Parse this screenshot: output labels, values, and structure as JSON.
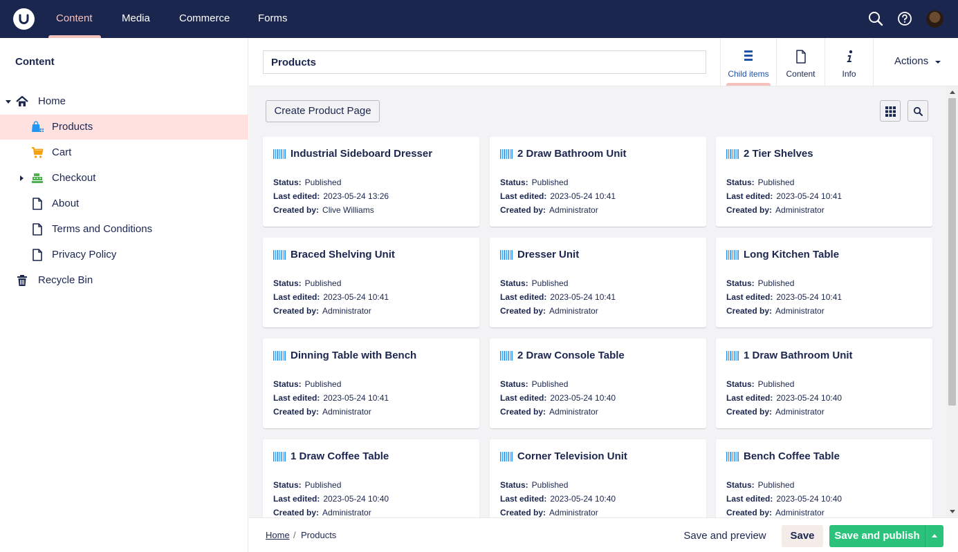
{
  "topbar": {
    "sections": [
      "Content",
      "Media",
      "Commerce",
      "Forms"
    ],
    "active_section": "Content"
  },
  "sidebar": {
    "title": "Content",
    "items": [
      {
        "label": "Home",
        "icon": "home-icon"
      },
      {
        "label": "Products",
        "icon": "shopping-bag-icon"
      },
      {
        "label": "Cart",
        "icon": "cart-icon"
      },
      {
        "label": "Checkout",
        "icon": "cash-register-icon"
      },
      {
        "label": "About",
        "icon": "document-icon"
      },
      {
        "label": "Terms and Conditions",
        "icon": "document-icon"
      },
      {
        "label": "Privacy Policy",
        "icon": "document-icon"
      },
      {
        "label": "Recycle Bin",
        "icon": "trash-icon"
      }
    ],
    "selected": "Products"
  },
  "header": {
    "name_value": "Products",
    "tabs": [
      {
        "label": "Child items",
        "icon": "list-icon"
      },
      {
        "label": "Content",
        "icon": "document-icon"
      },
      {
        "label": "Info",
        "icon": "info-icon"
      }
    ],
    "active_tab": "Child items",
    "actions_label": "Actions"
  },
  "toolbar": {
    "create_label": "Create Product Page"
  },
  "labels": {
    "status": "Status:",
    "last_edited": "Last edited:",
    "created_by": "Created by:"
  },
  "cards": [
    {
      "title": "Industrial Sideboard Dresser",
      "status": "Published",
      "last_edited": "2023-05-24 13:26",
      "created_by": "Clive Williams"
    },
    {
      "title": "2 Draw Bathroom Unit",
      "status": "Published",
      "last_edited": "2023-05-24 10:41",
      "created_by": "Administrator"
    },
    {
      "title": "2 Tier Shelves",
      "status": "Published",
      "last_edited": "2023-05-24 10:41",
      "created_by": "Administrator"
    },
    {
      "title": "Braced Shelving Unit",
      "status": "Published",
      "last_edited": "2023-05-24 10:41",
      "created_by": "Administrator"
    },
    {
      "title": "Dresser Unit",
      "status": "Published",
      "last_edited": "2023-05-24 10:41",
      "created_by": "Administrator"
    },
    {
      "title": "Long Kitchen Table",
      "status": "Published",
      "last_edited": "2023-05-24 10:41",
      "created_by": "Administrator"
    },
    {
      "title": "Dinning Table with Bench",
      "status": "Published",
      "last_edited": "2023-05-24 10:41",
      "created_by": "Administrator"
    },
    {
      "title": "2 Draw Console Table",
      "status": "Published",
      "last_edited": "2023-05-24 10:40",
      "created_by": "Administrator"
    },
    {
      "title": "1 Draw Bathroom Unit",
      "status": "Published",
      "last_edited": "2023-05-24 10:40",
      "created_by": "Administrator"
    },
    {
      "title": "1 Draw Coffee Table",
      "status": "Published",
      "last_edited": "2023-05-24 10:40",
      "created_by": "Administrator"
    },
    {
      "title": "Corner Television Unit",
      "status": "Published",
      "last_edited": "2023-05-24 10:40",
      "created_by": "Administrator"
    },
    {
      "title": "Bench Coffee Table",
      "status": "Published",
      "last_edited": "2023-05-24 10:40",
      "created_by": "Administrator"
    }
  ],
  "footer": {
    "breadcrumb": [
      "Home",
      "Products"
    ],
    "breadcrumb_sep": "/",
    "save_preview_label": "Save and preview",
    "save_label": "Save",
    "publish_label": "Save and publish"
  },
  "colors": {
    "topbar": "#1b264f",
    "accent": "#f5c1bc",
    "selected_row": "#ffe1e0",
    "publish": "#2bc37c",
    "barcode": "#2196f3"
  }
}
